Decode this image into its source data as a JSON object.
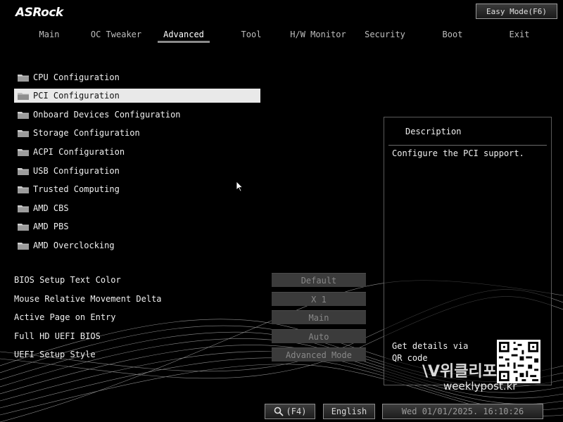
{
  "brand": {
    "logo": "ASRock"
  },
  "header": {
    "easy_mode_label": "Easy Mode(F6)"
  },
  "tabs": [
    {
      "label": "Main"
    },
    {
      "label": "OC Tweaker"
    },
    {
      "label": "Advanced",
      "active": true
    },
    {
      "label": "Tool"
    },
    {
      "label": "H/W Monitor"
    },
    {
      "label": "Security"
    },
    {
      "label": "Boot"
    },
    {
      "label": "Exit"
    }
  ],
  "menu": {
    "items": [
      {
        "label": "CPU Configuration",
        "icon": "folder-icon"
      },
      {
        "label": "PCI Configuration",
        "icon": "folder-icon",
        "selected": true
      },
      {
        "label": "Onboard Devices Configuration",
        "icon": "folder-icon"
      },
      {
        "label": "Storage Configuration",
        "icon": "folder-icon"
      },
      {
        "label": "ACPI Configuration",
        "icon": "folder-icon"
      },
      {
        "label": "USB Configuration",
        "icon": "folder-icon"
      },
      {
        "label": "Trusted Computing",
        "icon": "folder-icon"
      },
      {
        "label": "AMD CBS",
        "icon": "folder-icon"
      },
      {
        "label": "AMD PBS",
        "icon": "folder-icon"
      },
      {
        "label": "AMD Overclocking",
        "icon": "folder-icon"
      }
    ]
  },
  "settings": [
    {
      "label": "BIOS Setup Text Color",
      "value": "Default"
    },
    {
      "label": "Mouse Relative Movement Delta",
      "value": "X 1"
    },
    {
      "label": "Active Page on Entry",
      "value": "Main"
    },
    {
      "label": "Full HD UEFI BIOS",
      "value": "Auto"
    },
    {
      "label": "UEFI Setup Style",
      "value": "Advanced Mode"
    }
  ],
  "description": {
    "title": "Description",
    "text": "Configure the PCI support.",
    "qr_text": "Get details via QR code"
  },
  "watermark": {
    "line1": "\\V위클리포",
    "line2": "weeklypost.kr"
  },
  "bottom_bar": {
    "search_label": "(F4)",
    "language": "English",
    "datetime": "Wed 01/01/2025. 16:10:26"
  },
  "colors": {
    "background": "#000000",
    "selected_row": "#e9e9e9",
    "value_box": "#3b3b3b",
    "text": "#f0f0f0"
  }
}
